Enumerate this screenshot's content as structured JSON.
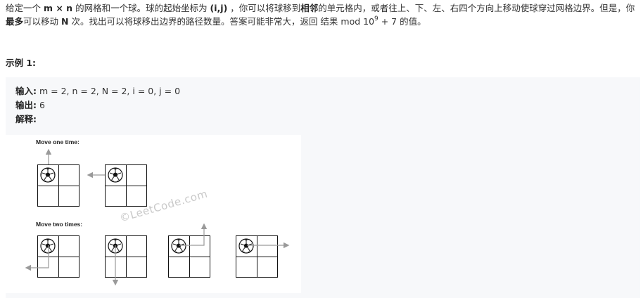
{
  "description": {
    "t1": "给定一个 ",
    "b1": "m × n",
    "t2": " 的网格和一个球。球的起始坐标为 ",
    "b2": "(i,j)",
    "t3": " ，你可以将球移到",
    "b3": "相邻",
    "t4": "的单元格内，或者往上、下、左、右四个方向上移动使球穿过网格边界。但是，你",
    "b4": "最多",
    "t5": "可以移动 ",
    "b5": "N",
    "t6": " 次。找出可以将球移出边界的路径数量。答案可能非常大，返回 结果 mod 10",
    "sup": "9",
    "t7": " + 7 的值。"
  },
  "example": {
    "title": "示例 1:",
    "input_label": "输入:",
    "input_value": " m = 2, n = 2, N = 2, i = 0, j = 0",
    "output_label": "输出:",
    "output_value": " 6",
    "explain_label": "解释:"
  },
  "figure": {
    "label_one": "Move one time:",
    "label_two": "Move two times:",
    "watermark": "©LeetCode.com"
  },
  "colors": {
    "arrow": "#9a9a9a",
    "grid": "#111111",
    "box_bg": "#f7f8fa"
  }
}
